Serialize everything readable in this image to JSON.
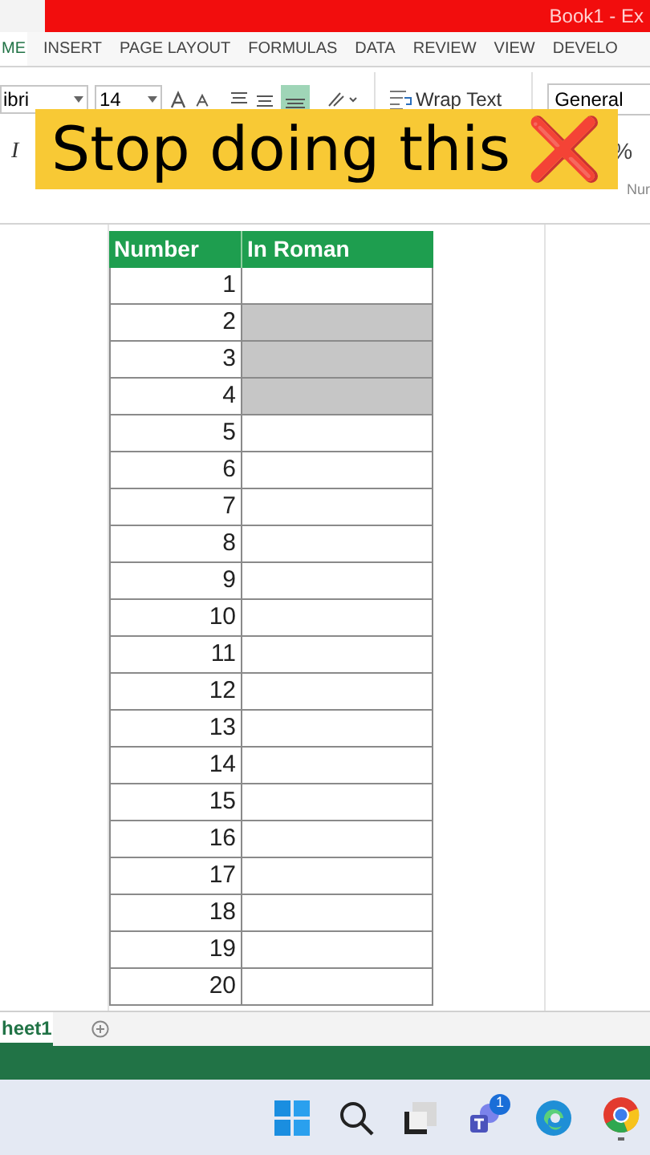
{
  "title_bar": {
    "title": "Book1 -  Ex"
  },
  "ribbon_tabs": [
    {
      "label": "ME",
      "selected": true
    },
    {
      "label": "INSERT",
      "selected": false
    },
    {
      "label": "PAGE LAYOUT",
      "selected": false
    },
    {
      "label": "FORMULAS",
      "selected": false
    },
    {
      "label": "DATA",
      "selected": false
    },
    {
      "label": "REVIEW",
      "selected": false
    },
    {
      "label": "VIEW",
      "selected": false
    },
    {
      "label": "DEVELO",
      "selected": false
    }
  ],
  "ribbon": {
    "font_name": "ibri",
    "font_size": "14",
    "wrap_text": "Wrap Text",
    "number_format": "General",
    "italic": "I",
    "percent": "%",
    "number_group": "Nur"
  },
  "banner": {
    "text": "Stop doing this",
    "mark": "❌"
  },
  "table": {
    "columns": [
      "Number",
      "In Roman"
    ],
    "rows": [
      {
        "number": "1",
        "selected": false
      },
      {
        "number": "2",
        "selected": true
      },
      {
        "number": "3",
        "selected": true
      },
      {
        "number": "4",
        "selected": true
      },
      {
        "number": "5",
        "selected": false
      },
      {
        "number": "6",
        "selected": false
      },
      {
        "number": "7",
        "selected": false
      },
      {
        "number": "8",
        "selected": false
      },
      {
        "number": "9",
        "selected": false
      },
      {
        "number": "10",
        "selected": false
      },
      {
        "number": "11",
        "selected": false
      },
      {
        "number": "12",
        "selected": false
      },
      {
        "number": "13",
        "selected": false
      },
      {
        "number": "14",
        "selected": false
      },
      {
        "number": "15",
        "selected": false
      },
      {
        "number": "16",
        "selected": false
      },
      {
        "number": "17",
        "selected": false
      },
      {
        "number": "18",
        "selected": false
      },
      {
        "number": "19",
        "selected": false
      },
      {
        "number": "20",
        "selected": false
      }
    ]
  },
  "sheet_tabs": [
    {
      "label": "heet1",
      "selected": true
    }
  ],
  "taskbar": {
    "teams_badge": "1"
  }
}
